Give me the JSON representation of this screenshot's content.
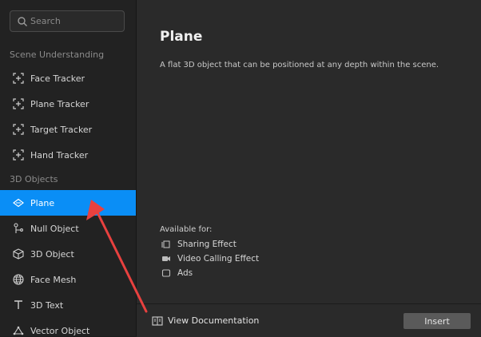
{
  "search": {
    "placeholder": "Search"
  },
  "sidebar": {
    "sections": [
      {
        "label": "Scene Understanding",
        "items": [
          {
            "label": "Face Tracker",
            "icon": "face-tracker-icon"
          },
          {
            "label": "Plane Tracker",
            "icon": "plane-tracker-icon"
          },
          {
            "label": "Target Tracker",
            "icon": "target-tracker-icon"
          },
          {
            "label": "Hand Tracker",
            "icon": "hand-tracker-icon"
          }
        ]
      },
      {
        "label": "3D Objects",
        "items": [
          {
            "label": "Plane",
            "icon": "plane-icon",
            "selected": true
          },
          {
            "label": "Null Object",
            "icon": "null-object-icon"
          },
          {
            "label": "3D Object",
            "icon": "cube-icon"
          },
          {
            "label": "Face Mesh",
            "icon": "face-mesh-icon"
          },
          {
            "label": "3D Text",
            "icon": "text-icon"
          },
          {
            "label": "Vector Object",
            "icon": "vector-object-icon"
          }
        ]
      }
    ]
  },
  "detail": {
    "title": "Plane",
    "description": "A flat 3D object that can be positioned at any depth within the scene.",
    "available_label": "Available for:",
    "platforms": [
      {
        "label": "Sharing Effect",
        "icon": "sharing-effect-icon"
      },
      {
        "label": "Video Calling Effect",
        "icon": "video-calling-icon"
      },
      {
        "label": "Ads",
        "icon": "ads-icon"
      }
    ]
  },
  "footer": {
    "doc_label": "View Documentation",
    "insert_label": "Insert"
  },
  "colors": {
    "accent": "#0a8ef6",
    "annotation_arrow": "#e8413f"
  }
}
